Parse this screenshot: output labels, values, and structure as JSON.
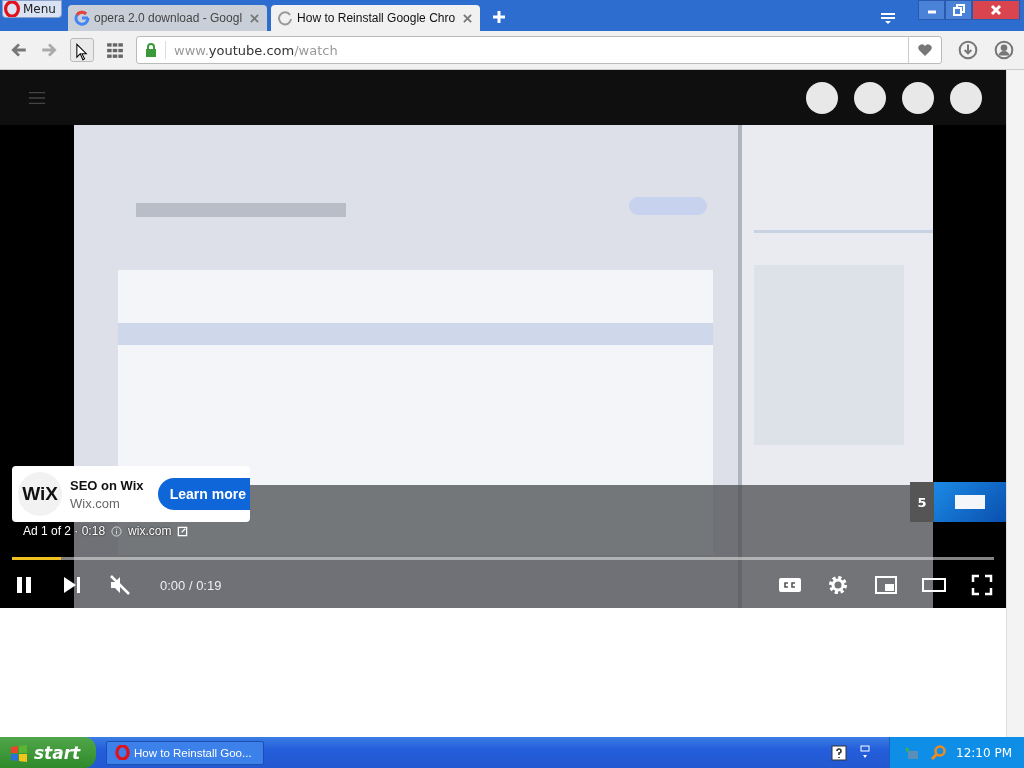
{
  "browser": {
    "menu_label": "Menu",
    "tabs": [
      {
        "title": "opera 2.0 download - Googl",
        "selected": false
      },
      {
        "title": "How to Reinstall Google Chro",
        "selected": true
      }
    ],
    "address": {
      "host": "www.",
      "domain": "youtube.com",
      "path": "/watch",
      "secure": true
    }
  },
  "player": {
    "playing": true,
    "muted": true,
    "time": "0:00 / 0:19",
    "level": 0.05,
    "ad": {
      "logo": "WiX",
      "title": "SEO on Wix",
      "site": "Wix.com",
      "button": "Learn more",
      "info": "Ad 1 of 2 · 0:18",
      "link": "wix.com"
    },
    "up_next": {
      "count": "5"
    }
  },
  "taskbar": {
    "start": "start",
    "windows": [
      {
        "title": "How to Reinstall Goo...",
        "selected": false
      }
    ],
    "clock": "12:10 PM"
  }
}
